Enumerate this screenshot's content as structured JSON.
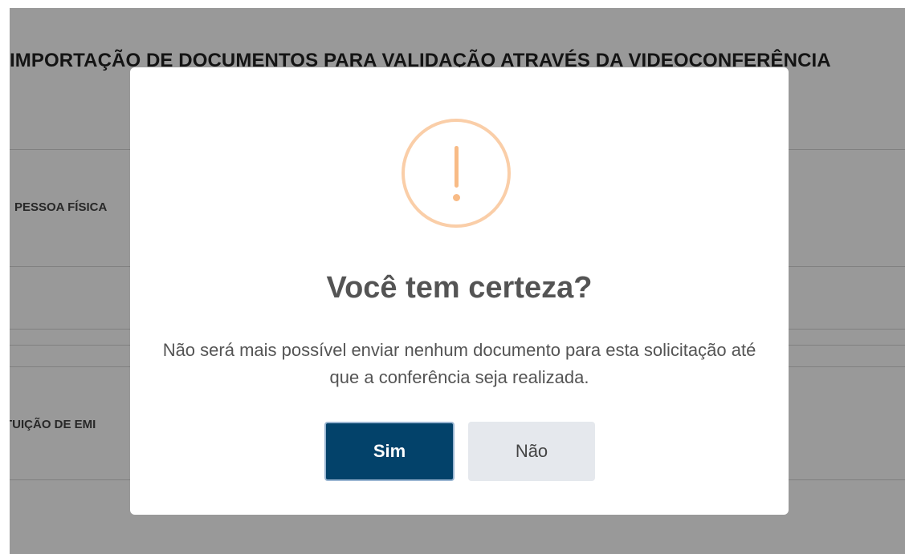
{
  "background": {
    "title": "IMPORTAÇÃO DE DOCUMENTOS PARA VALIDAÇÃO ATRAVÉS DA VIDEOCONFERÊNCIA",
    "sections": [
      "PESSOA FÍSICA",
      "TUIÇÃO DE EMI"
    ]
  },
  "dialog": {
    "icon": "warning-icon",
    "title": "Você tem certeza?",
    "message": "Não será mais possível enviar nenhum documento para esta solicitação até que a conferência seja realizada.",
    "confirm_label": "Sim",
    "cancel_label": "Não"
  },
  "colors": {
    "confirm_button": "#03426a",
    "cancel_button": "#e5e8ed",
    "warning_icon": "#f8bb86",
    "overlay": "rgba(0,0,0,0.4)"
  }
}
